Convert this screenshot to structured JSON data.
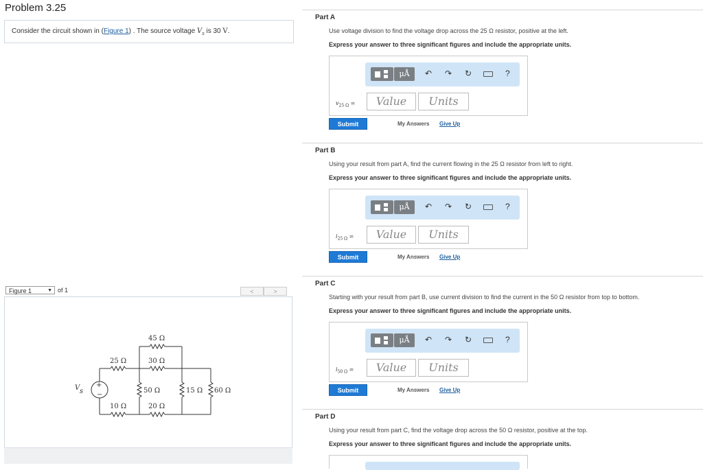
{
  "problem": {
    "title": "Problem 3.25",
    "intro_prefix": "Consider the circuit shown in (",
    "figure_link": "Figure 1",
    "intro_mid": ") . The source voltage ",
    "vs_symbol": "V",
    "vs_sub": "s",
    "intro_suffix": " is 30 ",
    "unit": "V",
    "period": "."
  },
  "figure": {
    "select_label": "Figure 1",
    "of_label": "of 1",
    "prev": "<",
    "next": ">",
    "vs": "V",
    "vs_sub": "s",
    "resistors": {
      "r45": "45 Ω",
      "r25": "25 Ω",
      "r30": "30 Ω",
      "r50": "50 Ω",
      "r15": "15 Ω",
      "r60": "60 Ω",
      "r10": "10 Ω",
      "r20": "20 Ω"
    },
    "plus": "+",
    "minus": "−"
  },
  "toolbar": {
    "mu": "μÅ",
    "undo": "↶",
    "redo": "↷",
    "reset": "↻",
    "help": "?"
  },
  "common": {
    "value_placeholder": "Value",
    "units_placeholder": "Units",
    "submit": "Submit",
    "my_answers": "My Answers",
    "give_up": "Give Up",
    "note": "Express your answer to three significant figures and include the appropriate units."
  },
  "parts": [
    {
      "label": "Part A",
      "desc": "Use voltage division to find the voltage drop across the 25 Ω resistor, positive at the left.",
      "var": "v",
      "sub": "25 Ω",
      "eq": " ="
    },
    {
      "label": "Part B",
      "desc": "Using your result from part A, find the current flowing in the 25 Ω resistor from left to right.",
      "var": "i",
      "sub": "25 Ω",
      "eq": " ="
    },
    {
      "label": "Part C",
      "desc": "Starting with your result from part B, use current division to find the current in the 50 Ω resistor from top to bottom.",
      "var": "i",
      "sub": "50 Ω",
      "eq": " ="
    },
    {
      "label": "Part D",
      "desc": "Using your result from part C, find the voltage drop across the 50 Ω resistor, positive at the top."
    }
  ]
}
